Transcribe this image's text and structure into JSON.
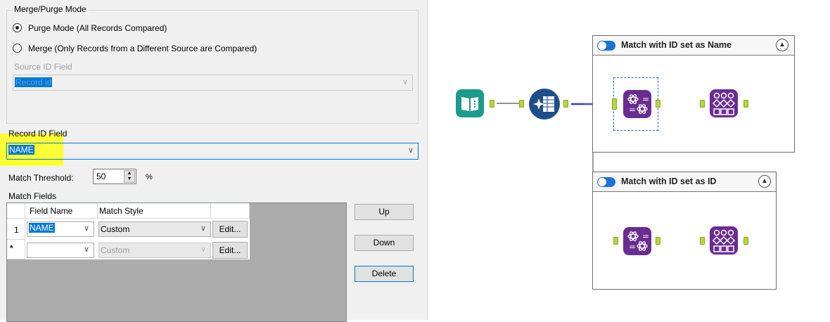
{
  "config": {
    "merge_purge": {
      "title": "Merge/Purge Mode",
      "purge_label": "Purge Mode (All Records Compared)",
      "merge_label": "Merge (Only Records from a Different Source are Compared)",
      "selected": "purge",
      "source_id_label": "Source ID Field",
      "source_id_value": "Record id"
    },
    "record_id": {
      "label": "Record ID Field",
      "value": "NAME",
      "highlight_color": "#ffff33"
    },
    "threshold": {
      "label": "Match Threshold:",
      "value": "50",
      "unit": "%"
    },
    "match_fields": {
      "label": "Match Fields",
      "headers": [
        "Field Name",
        "Match Style"
      ],
      "rows": [
        {
          "index": "1",
          "field": "NAME",
          "style": "Custom",
          "edit": "Edit..."
        },
        {
          "index": "*",
          "field": "",
          "style": "Custom",
          "edit": "Edit..."
        }
      ]
    },
    "buttons": {
      "up": "Up",
      "down": "Down",
      "delete": "Delete"
    }
  },
  "workflow": {
    "containers": [
      {
        "title": "Match with ID set as Name",
        "enabled": true,
        "collapse_icon": "chevron-up-icon"
      },
      {
        "title": "Match with ID set as ID",
        "enabled": true,
        "collapse_icon": "chevron-up-icon"
      }
    ],
    "tools": [
      "input-data-icon",
      "record-id-icon",
      "fuzzy-match-icon",
      "make-group-icon"
    ],
    "colors": {
      "tool_purple": "#6a2c91",
      "tool_teal": "#1c9b8c",
      "tool_blue": "#1f4f8a",
      "anchor_green": "#b5d63d",
      "selected_connection": "#2a3ccf"
    }
  }
}
